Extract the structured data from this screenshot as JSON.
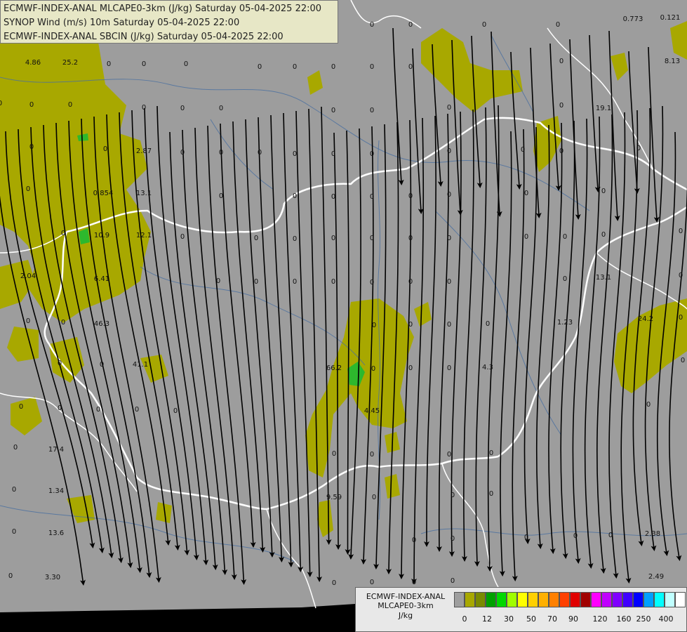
{
  "header": {
    "lines": [
      "ECMWF-INDEX-ANAL MLCAPE0-3km (J/kg) Saturday 05-04-2025 22:00",
      "SYNOP Wind (m/s) 10m Saturday 05-04-2025 22:00",
      "ECMWF-INDEX-ANAL SBCIN (J/kg) Saturday 05-04-2025 22:00"
    ]
  },
  "colorbar": {
    "title_line1": "ECMWF-INDEX-ANAL",
    "title_line2": "MLCAPE0-3km",
    "units": "J/kg",
    "colors": [
      "#9e9e9e",
      "#a8a800",
      "#7a8a00",
      "#00a000",
      "#00d800",
      "#a0ff00",
      "#ffff00",
      "#ffd000",
      "#ffb000",
      "#ff8000",
      "#ff4000",
      "#e00000",
      "#a00000",
      "#ff00ff",
      "#c000ff",
      "#8000ff",
      "#4000ff",
      "#0000ff",
      "#00a0ff",
      "#00ffff",
      "#c0ffff",
      "#ffffff"
    ],
    "tick_labels": [
      "0",
      "12",
      "30",
      "50",
      "70",
      "90",
      "120",
      "160",
      "250",
      "400"
    ]
  },
  "colors": {
    "background": "#9d9d9d",
    "cape_low": "#a8a800",
    "cape_mid": "#2db82d",
    "border": "#ffffff",
    "river": "#4a6fa0",
    "streamline": "#000000",
    "sea": "#000000"
  },
  "cin_labels": [
    {
      "text": "0"
    },
    {
      "text": "0"
    },
    {
      "text": "0"
    },
    {
      "text": "0"
    },
    {
      "text": "0"
    },
    {
      "text": "0"
    },
    {
      "text": "0.773"
    },
    {
      "text": "0.121"
    },
    {
      "text": "4.86"
    },
    {
      "text": "25.2"
    },
    {
      "text": "0"
    },
    {
      "text": "0"
    },
    {
      "text": "0"
    },
    {
      "text": "0"
    },
    {
      "text": "0"
    },
    {
      "text": "0"
    },
    {
      "text": "0"
    },
    {
      "text": "0"
    },
    {
      "text": "0"
    },
    {
      "text": "8.13"
    },
    {
      "text": "0"
    },
    {
      "text": "0"
    },
    {
      "text": "0"
    },
    {
      "text": "0"
    },
    {
      "text": "0"
    },
    {
      "text": "0"
    },
    {
      "text": "0"
    },
    {
      "text": "0"
    },
    {
      "text": "0"
    },
    {
      "text": "0"
    },
    {
      "text": "19.1"
    },
    {
      "text": "0"
    },
    {
      "text": "0"
    },
    {
      "text": "2.87"
    },
    {
      "text": "0"
    },
    {
      "text": "0"
    },
    {
      "text": "0"
    },
    {
      "text": "0"
    },
    {
      "text": "0"
    },
    {
      "text": "0"
    },
    {
      "text": "0"
    },
    {
      "text": "0"
    },
    {
      "text": "0"
    },
    {
      "text": "0"
    },
    {
      "text": "0"
    },
    {
      "text": "0.854"
    },
    {
      "text": "13.1"
    },
    {
      "text": "0"
    },
    {
      "text": "0"
    },
    {
      "text": "0"
    },
    {
      "text": "0"
    },
    {
      "text": "0"
    },
    {
      "text": "0"
    },
    {
      "text": "0"
    },
    {
      "text": "0"
    },
    {
      "text": "0"
    },
    {
      "text": "10.9"
    },
    {
      "text": "12.1"
    },
    {
      "text": "0"
    },
    {
      "text": "0"
    },
    {
      "text": "0"
    },
    {
      "text": "0"
    },
    {
      "text": "0"
    },
    {
      "text": "0"
    },
    {
      "text": "0"
    },
    {
      "text": "0"
    },
    {
      "text": "0"
    },
    {
      "text": "0"
    },
    {
      "text": "0"
    },
    {
      "text": "2.04"
    },
    {
      "text": "6.41"
    },
    {
      "text": "0"
    },
    {
      "text": "0"
    },
    {
      "text": "0"
    },
    {
      "text": "0"
    },
    {
      "text": "0"
    },
    {
      "text": "0"
    },
    {
      "text": "0"
    },
    {
      "text": "0"
    },
    {
      "text": "13.1"
    },
    {
      "text": "0"
    },
    {
      "text": "0"
    },
    {
      "text": "0"
    },
    {
      "text": "46.3"
    },
    {
      "text": "0"
    },
    {
      "text": "0"
    },
    {
      "text": "0"
    },
    {
      "text": "0"
    },
    {
      "text": "1.23"
    },
    {
      "text": "24.2"
    },
    {
      "text": "0"
    },
    {
      "text": "0"
    },
    {
      "text": "0"
    },
    {
      "text": "41.1"
    },
    {
      "text": "66.2"
    },
    {
      "text": "0"
    },
    {
      "text": "0"
    },
    {
      "text": "0"
    },
    {
      "text": "4.3"
    },
    {
      "text": "0"
    },
    {
      "text": "0"
    },
    {
      "text": "0"
    },
    {
      "text": "0"
    },
    {
      "text": "0"
    },
    {
      "text": "0"
    },
    {
      "text": "4.45"
    },
    {
      "text": "0"
    },
    {
      "text": "0"
    },
    {
      "text": "17.4"
    },
    {
      "text": "0"
    },
    {
      "text": "0"
    },
    {
      "text": "0"
    },
    {
      "text": "0"
    },
    {
      "text": "0"
    },
    {
      "text": "1.34"
    },
    {
      "text": "9.59"
    },
    {
      "text": "0"
    },
    {
      "text": "0"
    },
    {
      "text": "0"
    },
    {
      "text": "0"
    },
    {
      "text": "13.6"
    },
    {
      "text": "0"
    },
    {
      "text": "0"
    },
    {
      "text": "0"
    },
    {
      "text": "0"
    },
    {
      "text": "0"
    },
    {
      "text": "2.38"
    },
    {
      "text": "0"
    },
    {
      "text": "3.30"
    },
    {
      "text": "0"
    },
    {
      "text": "0"
    },
    {
      "text": "0"
    },
    {
      "text": "0"
    },
    {
      "text": "2.49"
    }
  ]
}
